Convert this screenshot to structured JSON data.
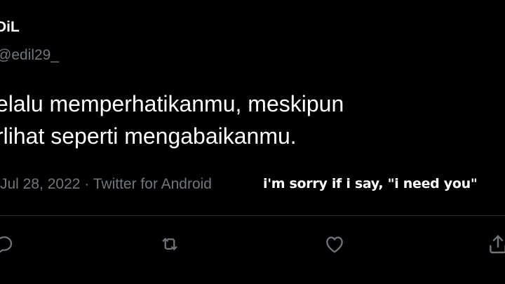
{
  "tweet": {
    "display_name": "DiL",
    "handle": "@edil29_",
    "text_lines": [
      "elalu memperhatikanmu, meskipun",
      "rlihat seperti mengabaikanmu."
    ],
    "date": "Jul 28, 2022",
    "separator": "·",
    "source": "Twitter for Android"
  },
  "overlay_caption": "i'm sorry if i say, \"i need you\"",
  "actions": {
    "reply_icon": "reply-icon",
    "retweet_icon": "retweet-icon",
    "like_icon": "heart-icon",
    "share_icon": "share-icon"
  },
  "colors": {
    "background": "#000000",
    "primary_text": "#ffffff",
    "secondary_text": "#71767b",
    "divider": "#2f3336"
  }
}
